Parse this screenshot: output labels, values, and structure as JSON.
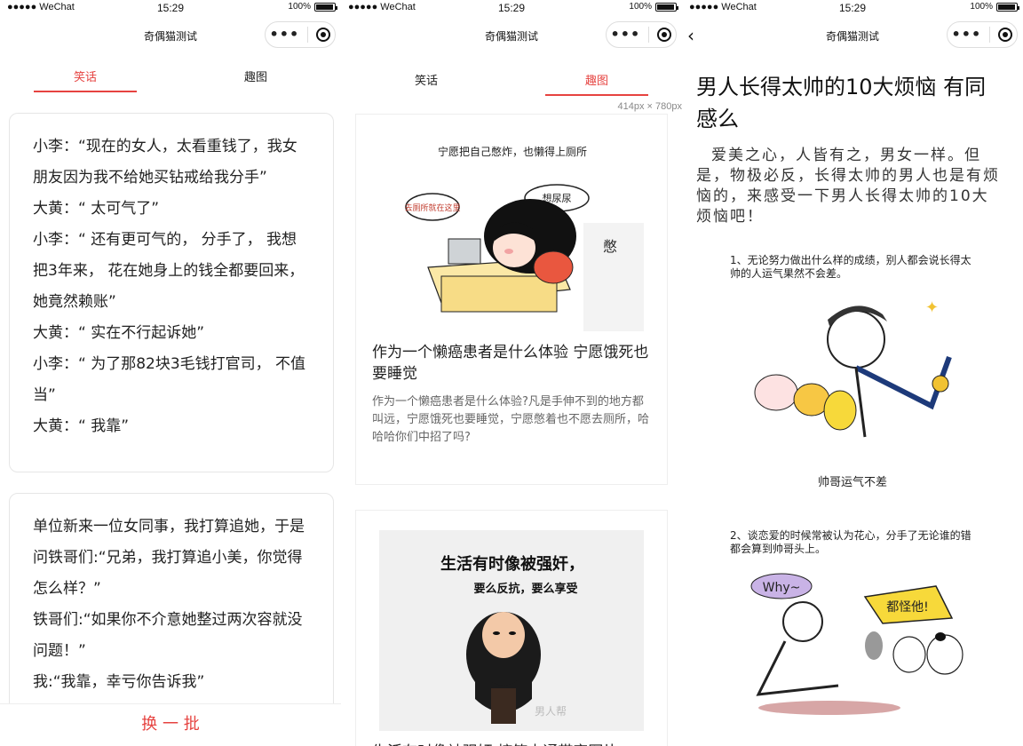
{
  "status_bar": {
    "carrier": "●●●●● WeChat",
    "time": "15:29",
    "battery": "100%"
  },
  "app_title": "奇偶猫测试",
  "tabs": {
    "jokes": "笑话",
    "pics": "趣图"
  },
  "jokes": [
    {
      "lines": [
        "小李：“现在的女人，太看重钱了，我女朋友因为我不给她买钻戒给我分手”",
        "大黄：“ 太可气了”",
        "小李：“ 还有更可气的， 分手了， 我想把3年来， 花在她身上的钱全都要回来， 她竟然赖账”",
        "大黄：“ 实在不行起诉她”",
        "小李：“ 为了那82块3毛钱打官司， 不值当”",
        "大黄：“ 我靠”"
      ]
    },
    {
      "lines": [
        "单位新来一位女同事，我打算追她，于是问铁哥们:“兄弟，我打算追小美，你觉得怎么样？”",
        "铁哥们:“如果你不介意她整过两次容就没问题！”",
        "我:“我靠，幸亏你告诉我”"
      ]
    }
  ],
  "refresh_label": "换 一 批",
  "dimension_hint": "414px × 780px",
  "pics": [
    {
      "image_caption": "宁愿把自己憋炸，也懒得上厕所",
      "bubble_left": "去厕所就在这里",
      "bubble_right": "想尿尿",
      "title": "作为一个懒癌患者是什么体验 宁愿饿死也要睡觉",
      "desc": "作为一个懒癌患者是什么体验?凡是手伸不到的地方都叫远，宁愿饿死也要睡觉，宁愿憋着也不愿去厕所，哈哈哈你们中招了吗?"
    },
    {
      "image_caption_line1": "生活有时像被强奸，",
      "image_caption_line2": "要么反抗，要么享受",
      "watermark": "男人帮",
      "title": "生活有时像被强奸 搞笑卡通带字图片"
    }
  ],
  "article": {
    "title": "男人长得太帅的10大烦恼 有同感么",
    "intro": "爱美之心，人皆有之，男女一样。但是，物极必反，长得太帅的男人也是有烦恼的，来感受一下男人长得太帅的10大烦恼吧！",
    "sections": [
      {
        "image_text": "1、无论努力做出什么样的成绩，别人都会说长得太帅的人运气果然不会差。",
        "caption": "帅哥运气不差"
      },
      {
        "image_text": "2、谈恋爱的时候常被认为花心，分手了无论谁的错都会算到帅哥头上。",
        "bubble1": "Why~",
        "bubble2": "都怪他!"
      }
    ]
  },
  "colors": {
    "accent": "#e64340"
  }
}
